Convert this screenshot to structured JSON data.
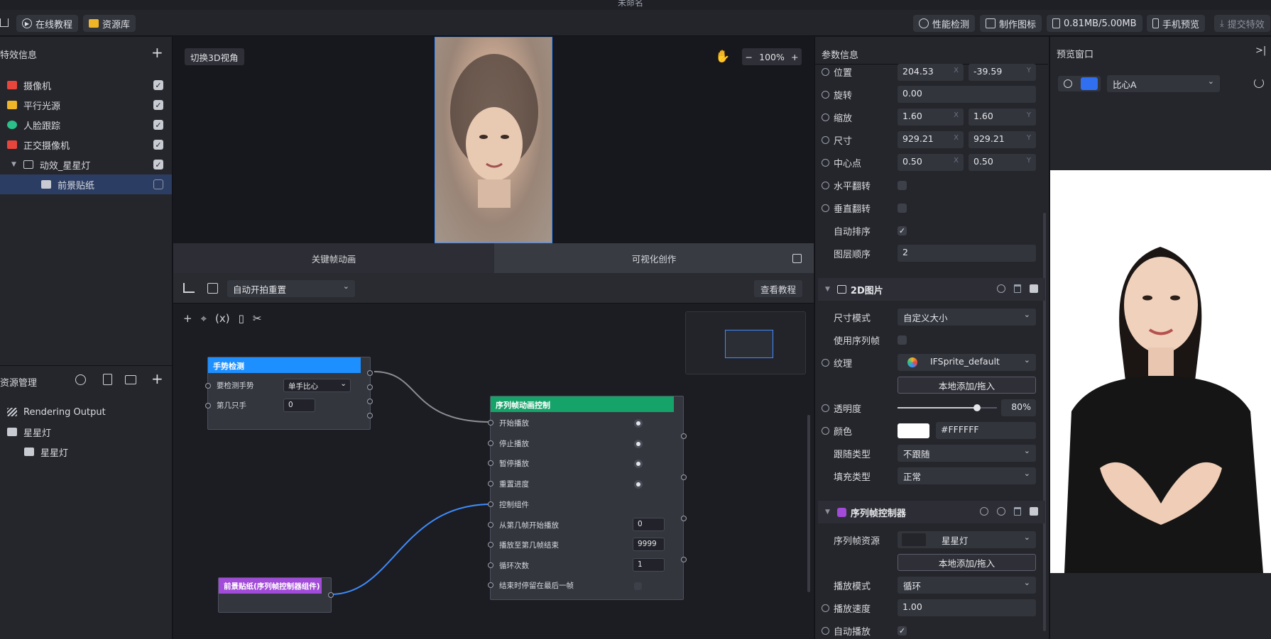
{
  "window": {
    "title": "未命名"
  },
  "toolbar": {
    "tutorial": "在线教程",
    "assets": "资源库",
    "perf": "性能检测",
    "make_icon": "制作图标",
    "size": "0.81MB/5.00MB",
    "mobile_preview": "手机预览",
    "submit": "提交特效"
  },
  "effect_panel": {
    "title": "特效信息",
    "items": [
      {
        "label": "摄像机",
        "icon": "camera-icon",
        "color": "#e8453c"
      },
      {
        "label": "平行光源",
        "icon": "light-icon",
        "color": "#f0b429"
      },
      {
        "label": "人脸跟踪",
        "icon": "face-track-icon",
        "color": "#2bbf8a"
      },
      {
        "label": "正交摄像机",
        "icon": "camera-icon",
        "color": "#e8453c"
      },
      {
        "label": "动效_星星灯",
        "icon": "group-icon",
        "color": "#c8cbd2"
      },
      {
        "label": "前景贴纸",
        "icon": "sticker-icon",
        "color": "#c8cbd2"
      }
    ]
  },
  "resource_panel": {
    "title": "资源管理",
    "items": [
      {
        "label": "Rendering Output",
        "icon": "render-output-icon"
      },
      {
        "label": "星星灯",
        "icon": "folder-icon"
      },
      {
        "label": "星星灯",
        "icon": "image-icon"
      }
    ]
  },
  "viewport": {
    "toggle3d": "切换3D视角",
    "zoom": "100%"
  },
  "center_tabs": {
    "keyframe": "关键帧动画",
    "visual": "可视化创作"
  },
  "graph_toolbar": {
    "select_value": "自动开拍重置",
    "view_tutorial": "查看教程"
  },
  "nodes": {
    "gesture": {
      "title": "手势检测",
      "color": "#1e8fff",
      "rows": [
        {
          "label": "要检测手势",
          "value": "单手比心"
        },
        {
          "label": "第几只手",
          "value": "0"
        }
      ]
    },
    "seq": {
      "title": "序列帧动画控制",
      "color": "#16a36a",
      "rows": [
        {
          "label": "开始播放"
        },
        {
          "label": "停止播放"
        },
        {
          "label": "暂停播放"
        },
        {
          "label": "重置进度"
        },
        {
          "label": "控制组件"
        },
        {
          "label": "从第几帧开始播放",
          "value": "0"
        },
        {
          "label": "播放至第几帧结束",
          "value": "9999"
        },
        {
          "label": "循环次数",
          "value": "1"
        },
        {
          "label": "结束时停留在最后一帧"
        }
      ]
    },
    "sticker": {
      "title": "前景贴纸(序列帧控制器组件)",
      "color": "#a24bd8"
    }
  },
  "props": {
    "title": "参数信息",
    "transform": [
      {
        "label": "位置",
        "x": "204.53",
        "y": "-39.59"
      },
      {
        "label": "旋转",
        "value": "0.00"
      },
      {
        "label": "缩放",
        "x": "1.60",
        "y": "1.60"
      },
      {
        "label": "尺寸",
        "x": "929.21",
        "y": "929.21"
      },
      {
        "label": "中心点",
        "x": "0.50",
        "y": "0.50"
      },
      {
        "label": "水平翻转"
      },
      {
        "label": "垂直翻转"
      },
      {
        "label": "自动排序"
      },
      {
        "label": "图层顺序",
        "value": "2"
      }
    ],
    "axis_x": "X",
    "axis_y": "Y",
    "image2d": {
      "title": "2D图片",
      "size_mode_label": "尺寸模式",
      "size_mode": "自定义大小",
      "use_seq_label": "使用序列帧",
      "texture_label": "纹理",
      "texture": "IFSprite_default",
      "add_local": "本地添加/拖入",
      "opacity_label": "透明度",
      "opacity": "80%",
      "opacity_value": 0.8,
      "color_label": "颜色",
      "color_hex": "#FFFFFF",
      "follow_label": "跟随类型",
      "follow": "不跟随",
      "fill_label": "填充类型",
      "fill": "正常"
    },
    "seqctrl": {
      "title": "序列帧控制器",
      "res_label": "序列帧资源",
      "res": "星星灯",
      "add_local": "本地添加/拖入",
      "mode_label": "播放模式",
      "mode": "循环",
      "speed_label": "播放速度",
      "speed": "1.00",
      "autoplay_label": "自动播放"
    }
  },
  "preview": {
    "title": "预览窗口",
    "gesture": "比心A"
  }
}
